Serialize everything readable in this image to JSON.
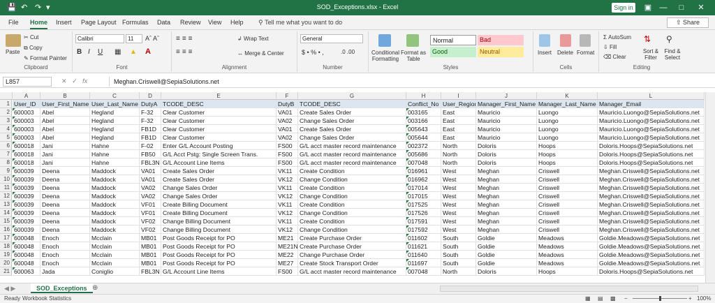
{
  "window": {
    "title": "SOD_Exceptions.xlsx - Excel",
    "sign_in": "Sign in",
    "share": "Share"
  },
  "tabs": [
    "File",
    "Home",
    "Insert",
    "Page Layout",
    "Formulas",
    "Data",
    "Review",
    "View",
    "Help"
  ],
  "active_tab": "Home",
  "tell_me": "Tell me what you want to do",
  "ribbon": {
    "clipboard": {
      "label": "Clipboard",
      "paste": "Paste",
      "cut": "Cut",
      "copy": "Copy",
      "format_painter": "Format Painter"
    },
    "font": {
      "label": "Font",
      "name": "Calibri",
      "size": "11"
    },
    "alignment": {
      "label": "Alignment",
      "wrap": "Wrap Text",
      "merge": "Merge & Center"
    },
    "number": {
      "label": "Number",
      "format": "General"
    },
    "styles": {
      "label": "Styles",
      "conditional": "Conditional Formatting",
      "format_table": "Format as Table",
      "normal": "Normal",
      "bad": "Bad",
      "good": "Good",
      "neutral": "Neutral"
    },
    "cells": {
      "label": "Cells",
      "insert": "Insert",
      "delete": "Delete",
      "format": "Format"
    },
    "editing": {
      "label": "Editing",
      "autosum": "AutoSum",
      "fill": "Fill",
      "clear": "Clear",
      "sort": "Sort & Filter",
      "find": "Find & Select"
    }
  },
  "name_box": "L857",
  "formula": "Meghan.Criswell@SepiaSolutions.net",
  "columns": [
    "A",
    "B",
    "C",
    "D",
    "E",
    "F",
    "G",
    "H",
    "I",
    "J",
    "K",
    "L"
  ],
  "rows": [
    [
      "User_ID",
      "User_First_Name",
      "User_Last_Name",
      "DutyA",
      "TCODE_DESC",
      "DutyB",
      "TCODE_DESC",
      "Conflict_No",
      "User_Region",
      "Manager_First_Name",
      "Manager_Last_Name",
      "Manager_Email"
    ],
    [
      "600003",
      "Abel",
      "Hegland",
      "F-32",
      "Clear Customer",
      "VA01",
      "Create Sales Order",
      "003165",
      "East",
      "Mauricio",
      "Luongo",
      "Mauricio.Luongo@SepiaSolutions.net"
    ],
    [
      "600003",
      "Abel",
      "Hegland",
      "F-32",
      "Clear Customer",
      "VA02",
      "Change Sales Order",
      "003166",
      "East",
      "Mauricio",
      "Luongo",
      "Mauricio.Luongo@SepiaSolutions.net"
    ],
    [
      "600003",
      "Abel",
      "Hegland",
      "FB1D",
      "Clear Customer",
      "VA01",
      "Create Sales Order",
      "005643",
      "East",
      "Mauricio",
      "Luongo",
      "Mauricio.Luongo@SepiaSolutions.net"
    ],
    [
      "600003",
      "Abel",
      "Hegland",
      "FB1D",
      "Clear Customer",
      "VA02",
      "Change Sales Order",
      "005644",
      "East",
      "Mauricio",
      "Luongo",
      "Mauricio.Luongo@SepiaSolutions.net"
    ],
    [
      "600018",
      "Jani",
      "Hahne",
      "F-02",
      "Enter G/L Account Posting",
      "FS00",
      "G/L acct master record maintenance",
      "002372",
      "North",
      "Doloris",
      "Hoops",
      "Doloris.Hoops@SepiaSolutions.net"
    ],
    [
      "600018",
      "Jani",
      "Hahne",
      "FB50",
      "G/L Acct Pstg: Single Screen Trans.",
      "FS00",
      "G/L acct master record maintenance",
      "005686",
      "North",
      "Doloris",
      "Hoops",
      "Doloris.Hoops@SepiaSolutions.net"
    ],
    [
      "600018",
      "Jani",
      "Hahne",
      "FBL3N",
      "G/L Account Line Items",
      "FS00",
      "G/L acct master record maintenance",
      "007048",
      "North",
      "Doloris",
      "Hoops",
      "Doloris.Hoops@SepiaSolutions.net"
    ],
    [
      "600039",
      "Deena",
      "Maddock",
      "VA01",
      "Create Sales Order",
      "VK11",
      "Create Condition",
      "016961",
      "West",
      "Meghan",
      "Criswell",
      "Meghan.Criswell@SepiaSolutions.net"
    ],
    [
      "600039",
      "Deena",
      "Maddock",
      "VA01",
      "Create Sales Order",
      "VK12",
      "Change Condition",
      "016962",
      "West",
      "Meghan",
      "Criswell",
      "Meghan.Criswell@SepiaSolutions.net"
    ],
    [
      "600039",
      "Deena",
      "Maddock",
      "VA02",
      "Change Sales Order",
      "VK11",
      "Create Condition",
      "017014",
      "West",
      "Meghan",
      "Criswell",
      "Meghan.Criswell@SepiaSolutions.net"
    ],
    [
      "600039",
      "Deena",
      "Maddock",
      "VA02",
      "Change Sales Order",
      "VK12",
      "Change Condition",
      "017015",
      "West",
      "Meghan",
      "Criswell",
      "Meghan.Criswell@SepiaSolutions.net"
    ],
    [
      "600039",
      "Deena",
      "Maddock",
      "VF01",
      "Create Billing Document",
      "VK11",
      "Create Condition",
      "017525",
      "West",
      "Meghan",
      "Criswell",
      "Meghan.Criswell@SepiaSolutions.net"
    ],
    [
      "600039",
      "Deena",
      "Maddock",
      "VF01",
      "Create Billing Document",
      "VK12",
      "Change Condition",
      "017526",
      "West",
      "Meghan",
      "Criswell",
      "Meghan.Criswell@SepiaSolutions.net"
    ],
    [
      "600039",
      "Deena",
      "Maddock",
      "VF02",
      "Change Billing Document",
      "VK11",
      "Create Condition",
      "017591",
      "West",
      "Meghan",
      "Criswell",
      "Meghan.Criswell@SepiaSolutions.net"
    ],
    [
      "600039",
      "Deena",
      "Maddock",
      "VF02",
      "Change Billing Document",
      "VK12",
      "Change Condition",
      "017592",
      "West",
      "Meghan",
      "Criswell",
      "Meghan.Criswell@SepiaSolutions.net"
    ],
    [
      "600048",
      "Enoch",
      "Mcclain",
      "MB01",
      "Post Goods Receipt for PO",
      "ME21",
      "Create Purchase Order",
      "011602",
      "South",
      "Goldie",
      "Meadows",
      "Goldie.Meadows@SepiaSolutions.net"
    ],
    [
      "600048",
      "Enoch",
      "Mcclain",
      "MB01",
      "Post Goods Receipt for PO",
      "ME21N",
      "Create Purchase Order",
      "011621",
      "South",
      "Goldie",
      "Meadows",
      "Goldie.Meadows@SepiaSolutions.net"
    ],
    [
      "600048",
      "Enoch",
      "Mcclain",
      "MB01",
      "Post Goods Receipt for PO",
      "ME22",
      "Change Purchase Order",
      "011640",
      "South",
      "Goldie",
      "Meadows",
      "Goldie.Meadows@SepiaSolutions.net"
    ],
    [
      "600048",
      "Enoch",
      "Mcclain",
      "MB01",
      "Post Goods Receipt for PO",
      "ME27",
      "Create Stock Transport Order",
      "011697",
      "South",
      "Goldie",
      "Meadows",
      "Goldie.Meadows@SepiaSolutions.net"
    ],
    [
      "600063",
      "Jada",
      "Coniglio",
      "FBL3N",
      "G/L Account Line Items",
      "FS00",
      "G/L acct master record maintenance",
      "007048",
      "North",
      "Doloris",
      "Hoops",
      "Doloris.Hoops@SepiaSolutions.net"
    ]
  ],
  "sheet_tab": "SOD_Exceptions",
  "status": {
    "ready": "Ready",
    "workbook_stats": "Workbook Statistics",
    "zoom": "100%"
  }
}
